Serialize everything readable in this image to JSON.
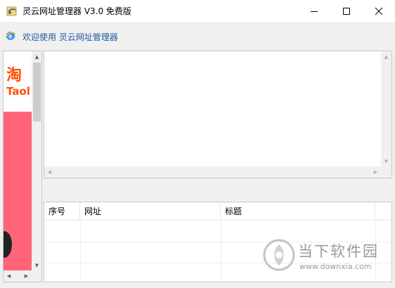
{
  "window": {
    "title": "灵云网址管理器 V3.0 免费版",
    "app_icon": "app-logo-icon",
    "controls": {
      "minimize_icon": "minimize-icon",
      "maximize_icon": "maximize-icon",
      "close_icon": "close-icon"
    }
  },
  "welcome_bar": {
    "icon": "ie-browser-icon",
    "text": "欢迎使用  灵云网址管理器",
    "link_color": "#1f5aa0"
  },
  "left_panel": {
    "ad": {
      "line1": "淘",
      "line2": "Taol",
      "brand_color": "#ff5000",
      "banner_color": "#ff6479"
    }
  },
  "table": {
    "columns": [
      "序号",
      "网址",
      "标题",
      ""
    ],
    "rows": []
  },
  "watermark": {
    "title": "当下软件园",
    "url": "www.downxia.com"
  }
}
